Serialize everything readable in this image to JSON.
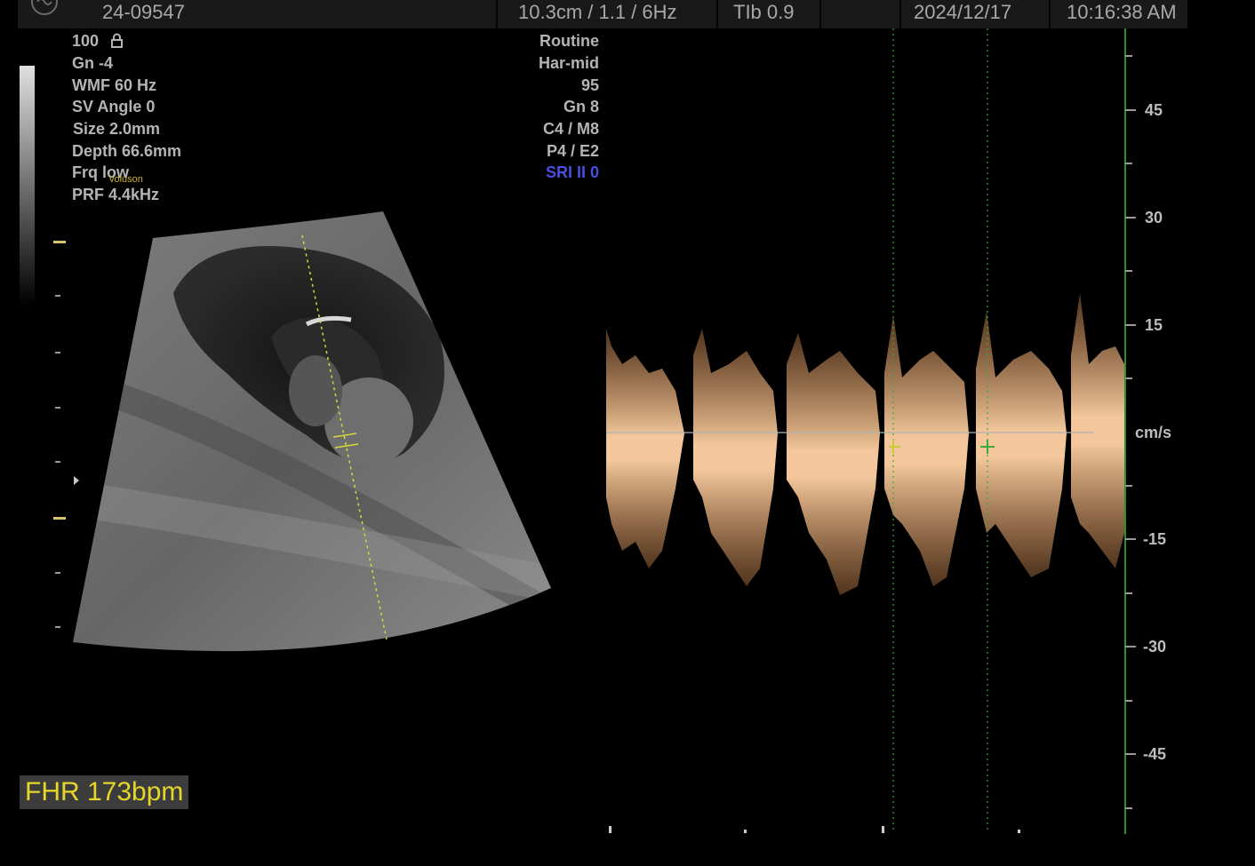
{
  "header": {
    "patient_id": "24-09547",
    "scan_params": "10.3cm / 1.1 /  6Hz",
    "tib": "TIb 0.9",
    "date": "2024/12/17",
    "time": "10:16:38 AM"
  },
  "left_params": {
    "power": "100",
    "gain": "Gn  -4",
    "wmf": "WMF 60 Hz",
    "sv_angle": "SV Angle  0",
    "size": "Size  2.0mm",
    "depth": "Depth 66.6mm",
    "frequency": "Frq low",
    "prf": "PRF  4.4kHz",
    "watermark": "voluson"
  },
  "right_params": {
    "preset": "Routine",
    "harmonic": "Har-mid",
    "value": "95",
    "gain": "Gn   8",
    "c_m": "C4 / M8",
    "p_e": "P4 / E2",
    "sri": "SRI II 0"
  },
  "doppler_scale": {
    "unit": "cm/s",
    "ticks": [
      "45",
      "30",
      "15",
      "-15",
      "-30",
      "-45"
    ],
    "values": [
      45,
      30,
      15,
      -15,
      -30,
      -45
    ]
  },
  "measurement": {
    "fhr": "FHR 173bpm"
  },
  "colors": {
    "background": "#000000",
    "topbar": "#191919",
    "text": "#b4b4b4",
    "sri": "#4a4fe0",
    "fhr_text": "#e6d62a",
    "doppler": "#e8a56a",
    "caliper_yellow": "#c9c93a",
    "caliper_green": "#3aa83a",
    "scale_line": "#2f8f2f"
  },
  "icons": {
    "logo": "ge-logo",
    "lock": "lock-icon"
  }
}
